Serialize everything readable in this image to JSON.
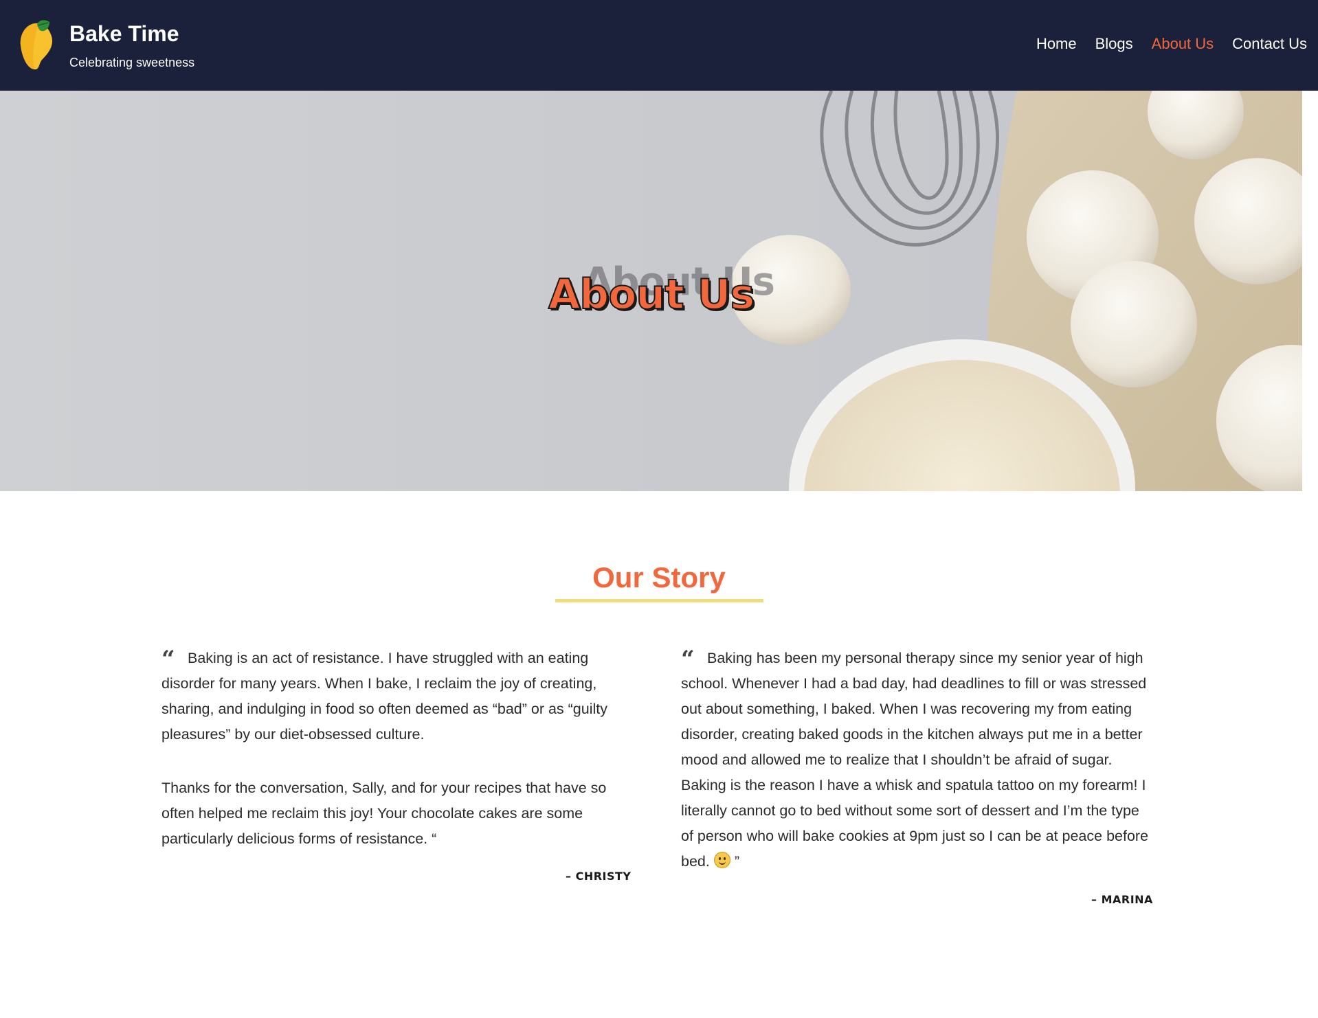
{
  "header": {
    "brand_title": "Bake Time",
    "brand_tagline": "Celebrating sweetness",
    "logo_icon": "mango-icon",
    "nav": [
      {
        "label": "Home",
        "active": false
      },
      {
        "label": "Blogs",
        "active": false
      },
      {
        "label": "About Us",
        "active": true
      },
      {
        "label": "Contact Us",
        "active": false
      }
    ]
  },
  "hero": {
    "title": "About Us",
    "title_shadow": "About Us"
  },
  "story": {
    "title": "Our Story",
    "testimonials": [
      {
        "paragraphs": [
          "Baking is an act of resistance. I have struggled with an eating disorder for many years. When I bake, I reclaim the joy of creating, sharing, and indulging in food so often deemed as “bad” or as “guilty pleasures” by our diet-obsessed culture.",
          "Thanks for the conversation, Sally, and for your recipes that have so often helped me reclaim this joy! Your chocolate cakes are some particularly delicious forms of resistance. “"
        ],
        "author": "– CHRISTY"
      },
      {
        "paragraphs": [
          "Baking has been my personal therapy since my senior year of high school. Whenever I had a bad day, had deadlines to fill or was stressed out about something, I baked. When I was recovering my from eating disorder, creating baked goods in the kitchen always put me in a better mood and allowed me to realize that I shouldn’t be afraid of sugar. Baking is the reason I have a whisk and spatula tattoo on my forearm! I literally cannot go to bed without some sort of dessert and I’m the type of person who will bake cookies at 9pm just so I can be at peace before bed."
        ],
        "closing": "”",
        "emoji_icon": "smiley-icon",
        "author": "– MARINA"
      }
    ]
  },
  "colors": {
    "header_bg": "#1b213a",
    "accent": "#f2683c",
    "underline": "#f0dc7e"
  }
}
